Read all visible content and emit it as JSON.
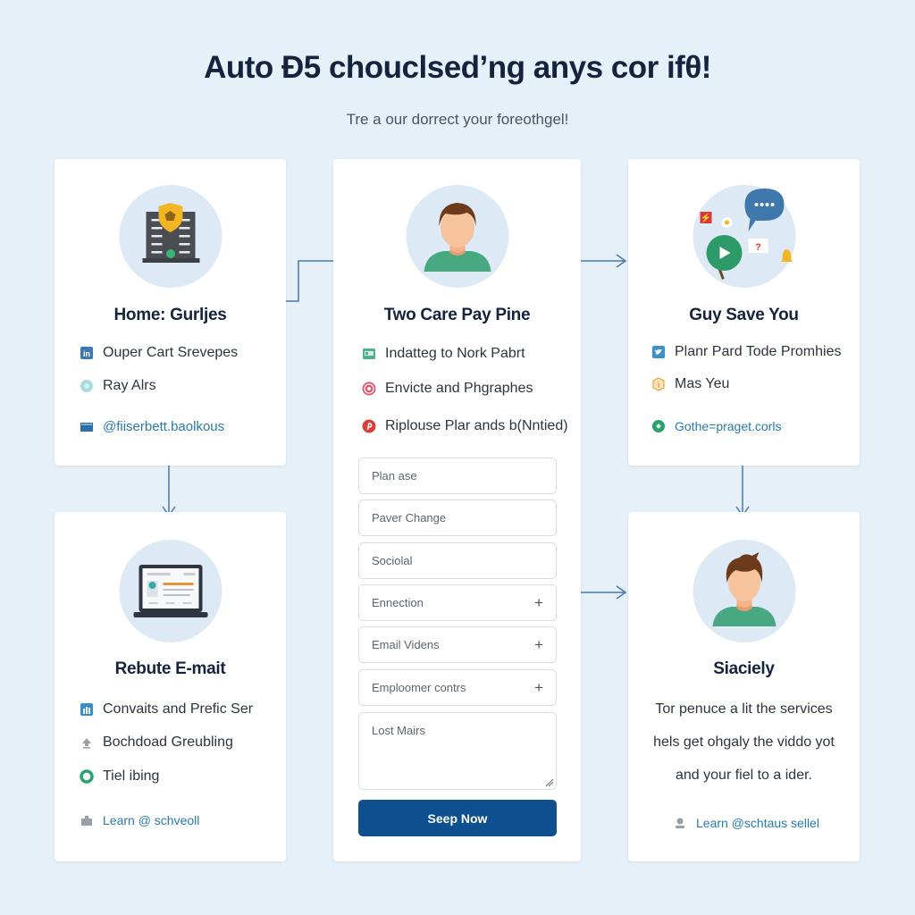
{
  "header": {
    "title": "Auto Đ5 chouclsed’ng anys cor ifθ!",
    "subtitle": "Tre a  our dorrect your foreothgel!"
  },
  "colors": {
    "background": "#e6f0f8",
    "card": "#ffffff",
    "accent": "#0e4f8f",
    "connector": "#4a78a8",
    "link": "#2a7aa8"
  },
  "cards": {
    "home": {
      "icon": "secure-building-icon",
      "title": "Home: Gurljes",
      "items": [
        {
          "icon": "linkedin-icon",
          "label": "Ouper Cart Srevepes"
        },
        {
          "icon": "circle-badge-icon",
          "label": "Ray Alrs"
        },
        {
          "icon": "email-icon",
          "label": "@fiiserbett.baolkous"
        }
      ]
    },
    "pay": {
      "icon": "user-avatar-icon",
      "title": "Two Care Pay Pine",
      "items": [
        {
          "icon": "id-card-icon",
          "label": "Indatteg to Nork Pabrt"
        },
        {
          "icon": "instagram-icon",
          "label": "Envicte and Phgraphes"
        },
        {
          "icon": "pinterest-icon",
          "label": "Riplouse Plar ands b(Nntied)"
        }
      ],
      "form": {
        "fields": [
          {
            "placeholder": "Plan ase",
            "expandable": false
          },
          {
            "placeholder": "Paver Change",
            "expandable": false
          },
          {
            "placeholder": "Sociolal",
            "expandable": false
          },
          {
            "placeholder": "Ennection",
            "expandable": true
          },
          {
            "placeholder": "Email Videns",
            "expandable": true
          },
          {
            "placeholder": "Emploomer contrs",
            "expandable": true
          }
        ],
        "plus_symbol": "+",
        "textarea_placeholder": "Lost Mairs",
        "submit_label": "Seep Now"
      }
    },
    "save": {
      "icon": "social-chat-icon",
      "title": "Guy Save You",
      "items": [
        {
          "icon": "twitter-icon",
          "label": "Planr Pard Tode Promhies"
        },
        {
          "icon": "info-badge-icon",
          "label": "Mas Yeu"
        },
        {
          "icon": "globe-icon",
          "label": "Gothe=praget.corls"
        }
      ]
    },
    "email": {
      "icon": "laptop-icon",
      "title": "Rebute E-mait",
      "items": [
        {
          "icon": "chart-icon",
          "label": "Convaits and Prefic Ser"
        },
        {
          "icon": "upload-icon",
          "label": "Bochdoad Greubling"
        },
        {
          "icon": "ring-icon",
          "label": "Tiel ibing"
        },
        {
          "icon": "briefcase-icon",
          "label": "Learn @ schveoll"
        }
      ]
    },
    "society": {
      "icon": "user-avatar-icon",
      "title": "Siaciely",
      "description": [
        "Tor penuce  a lit the services",
        "hels get ohgaly the viddo yot",
        "and your fiel to a ider."
      ],
      "link": {
        "icon": "person-icon",
        "label": "Learn @schtaus sellel"
      }
    }
  }
}
